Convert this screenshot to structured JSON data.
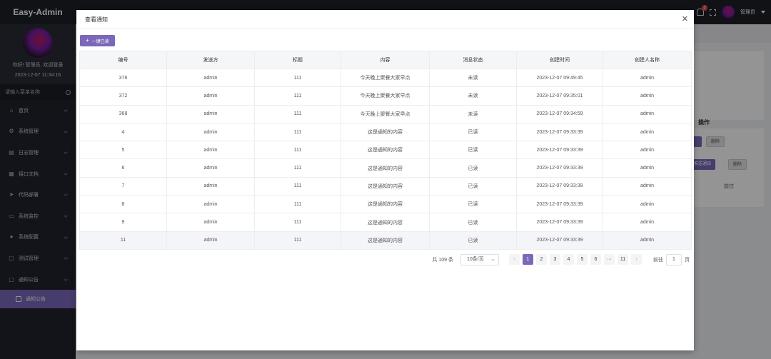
{
  "app": {
    "title": "Easy-Admin"
  },
  "user": {
    "greeting": "你好! 管理员, 欢迎登录",
    "login_time": "2023-12-07 11:34:16",
    "name": "管理员"
  },
  "menu_search": {
    "placeholder": "请输入菜单名称"
  },
  "menu": [
    {
      "label": "首页",
      "icon": "home-icon"
    },
    {
      "label": "系统管理",
      "icon": "gear-icon"
    },
    {
      "label": "日志管理",
      "icon": "document-icon"
    },
    {
      "label": "接口文档",
      "icon": "grid-icon"
    },
    {
      "label": "代码部署",
      "icon": "send-icon"
    },
    {
      "label": "系统监控",
      "icon": "monitor-icon"
    },
    {
      "label": "系统配置",
      "icon": "settings-icon"
    },
    {
      "label": "测试管理",
      "icon": "file-icon"
    },
    {
      "label": "通知公告",
      "icon": "file-icon"
    }
  ],
  "submenu": {
    "label": "通知公告"
  },
  "topbar": {
    "bell_badge": "3"
  },
  "background": {
    "op_header": "操作",
    "btn_delete": "删除",
    "btn_push": "推送通知",
    "goto_label": "前往",
    "goto_page": "1"
  },
  "modal": {
    "title": "查看通知",
    "read_all_button": "一键已读",
    "columns": [
      "编号",
      "发送方",
      "标题",
      "内容",
      "消息状态",
      "创建时间",
      "创建人名称"
    ],
    "rows": [
      {
        "id": "376",
        "sender": "admin",
        "title": "111",
        "content": "今天晚上聚餐大家早点",
        "status": "未读",
        "read": false,
        "time": "2023-12-07 09:49:45",
        "creator": "admin"
      },
      {
        "id": "372",
        "sender": "admin",
        "title": "111",
        "content": "今天晚上聚餐大家早点",
        "status": "未读",
        "read": false,
        "time": "2023-12-07 09:35:01",
        "creator": "admin"
      },
      {
        "id": "368",
        "sender": "admin",
        "title": "111",
        "content": "今天晚上聚餐大家早点",
        "status": "未读",
        "read": false,
        "time": "2023-12-07 09:34:59",
        "creator": "admin"
      },
      {
        "id": "4",
        "sender": "admin",
        "title": "111",
        "content": "这是通知的内容",
        "status": "已读",
        "read": true,
        "time": "2023-12-07 09:33:39",
        "creator": "admin"
      },
      {
        "id": "5",
        "sender": "admin",
        "title": "111",
        "content": "这是通知的内容",
        "status": "已读",
        "read": true,
        "time": "2023-12-07 09:33:39",
        "creator": "admin"
      },
      {
        "id": "6",
        "sender": "admin",
        "title": "111",
        "content": "这是通知的内容",
        "status": "已读",
        "read": true,
        "time": "2023-12-07 09:33:39",
        "creator": "admin"
      },
      {
        "id": "7",
        "sender": "admin",
        "title": "111",
        "content": "这是通知的内容",
        "status": "已读",
        "read": true,
        "time": "2023-12-07 09:33:39",
        "creator": "admin"
      },
      {
        "id": "8",
        "sender": "admin",
        "title": "111",
        "content": "这是通知的内容",
        "status": "已读",
        "read": true,
        "time": "2023-12-07 09:33:39",
        "creator": "admin"
      },
      {
        "id": "9",
        "sender": "admin",
        "title": "111",
        "content": "这是通知的内容",
        "status": "已读",
        "read": true,
        "time": "2023-12-07 09:33:39",
        "creator": "admin"
      },
      {
        "id": "11",
        "sender": "admin",
        "title": "111",
        "content": "这是通知的内容",
        "status": "已读",
        "read": true,
        "time": "2023-12-07 09:33:39",
        "creator": "admin"
      }
    ],
    "pagination": {
      "total": "共 109 条",
      "page_size": "10条/页",
      "pages": [
        "1",
        "2",
        "3",
        "4",
        "5",
        "6",
        "···",
        "11"
      ],
      "current": "1",
      "goto_label": "前往",
      "goto_value": "1",
      "page_suffix": "页"
    }
  },
  "colors": {
    "accent": "#7b68ba",
    "unread": "#e0301e",
    "read": "#1a9a2a",
    "sidebar": "#22242c"
  }
}
